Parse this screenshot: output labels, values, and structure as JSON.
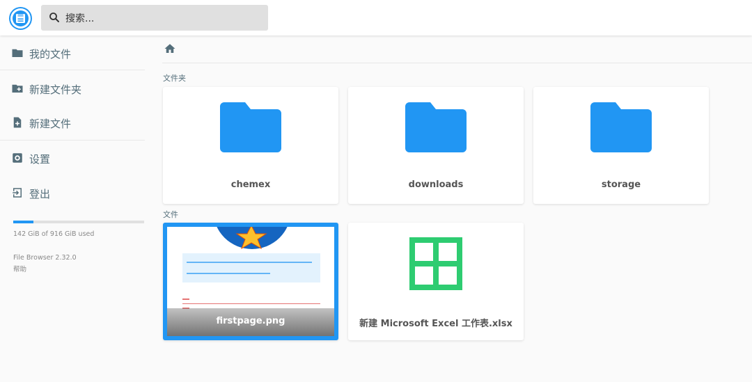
{
  "header": {
    "search_placeholder": "搜索..."
  },
  "sidebar": {
    "items": [
      {
        "label": "我的文件",
        "icon": "folder-icon"
      },
      {
        "label": "新建文件夹",
        "icon": "create-new-folder-icon"
      },
      {
        "label": "新建文件",
        "icon": "note-add-icon"
      },
      {
        "label": "设置",
        "icon": "settings-icon"
      },
      {
        "label": "登出",
        "icon": "exit-icon"
      }
    ],
    "usage_text": "142 GiB of 916 GiB used",
    "usage_fraction": 0.155,
    "version": "File Browser 2.32.0",
    "help": "帮助"
  },
  "main": {
    "breadcrumb_icon": "home-icon",
    "folders_title": "文件夹",
    "files_title": "文件",
    "folders": [
      {
        "name": "chemex"
      },
      {
        "name": "downloads"
      },
      {
        "name": "storage"
      }
    ],
    "files": [
      {
        "name": "firstpage.png",
        "type": "image",
        "selected": true
      },
      {
        "name": "新建 Microsoft Excel 工作表.xlsx",
        "type": "spreadsheet",
        "selected": false
      }
    ]
  },
  "colors": {
    "accent": "#2196f3",
    "excel_green": "#2ecc71",
    "text": "#546e7a"
  }
}
